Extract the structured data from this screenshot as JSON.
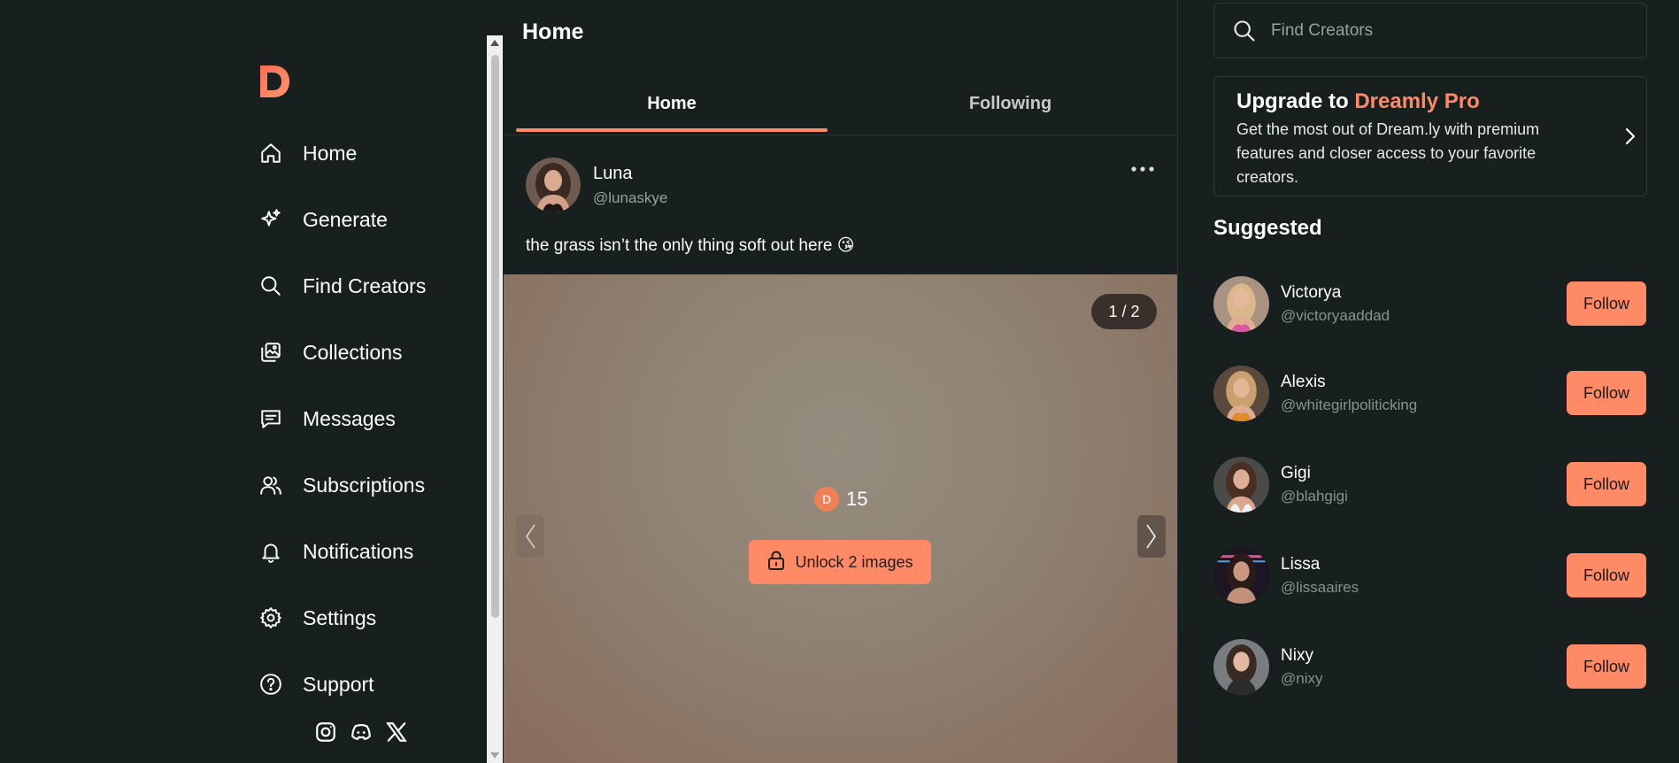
{
  "colors": {
    "accent": "#ff8a65",
    "background": "#181f1f",
    "muted_text": "#9aa0a0"
  },
  "sidebar": {
    "logo_icon": "dreamly-logo",
    "items": [
      {
        "label": "Home",
        "icon": "home-icon"
      },
      {
        "label": "Generate",
        "icon": "sparkles-icon"
      },
      {
        "label": "Find Creators",
        "icon": "search-icon"
      },
      {
        "label": "Collections",
        "icon": "images-icon"
      },
      {
        "label": "Messages",
        "icon": "message-icon"
      },
      {
        "label": "Subscriptions",
        "icon": "users-icon"
      },
      {
        "label": "Notifications",
        "icon": "bell-icon"
      },
      {
        "label": "Settings",
        "icon": "gear-icon"
      },
      {
        "label": "Support",
        "icon": "help-icon"
      }
    ],
    "social": [
      "instagram-icon",
      "discord-icon",
      "x-icon"
    ]
  },
  "feed": {
    "title": "Home",
    "tabs": [
      {
        "label": "Home",
        "active": true
      },
      {
        "label": "Following",
        "active": false
      }
    ],
    "post": {
      "author_name": "Luna",
      "author_handle": "@lunaskye",
      "caption": "the grass isn’t the only thing soft out here 😘",
      "counter": "1 / 2",
      "coin_letter": "D",
      "price": "15",
      "unlock_label": "Unlock 2 images"
    }
  },
  "right": {
    "search_placeholder": "Find Creators",
    "upgrade": {
      "title_prefix": "Upgrade to ",
      "title_brand": "Dreamly Pro",
      "description": "Get the most out of Dream.ly with premium features and closer access to your favorite creators."
    },
    "suggested_title": "Suggested",
    "follow_label": "Follow",
    "creators": [
      {
        "name": "Victorya",
        "handle": "@victoryaaddad"
      },
      {
        "name": "Alexis",
        "handle": "@whitegirlpoliticking"
      },
      {
        "name": "Gigi",
        "handle": "@blahgigi"
      },
      {
        "name": "Lissa",
        "handle": "@lissaaires"
      },
      {
        "name": "Nixy",
        "handle": "@nixy"
      }
    ]
  }
}
